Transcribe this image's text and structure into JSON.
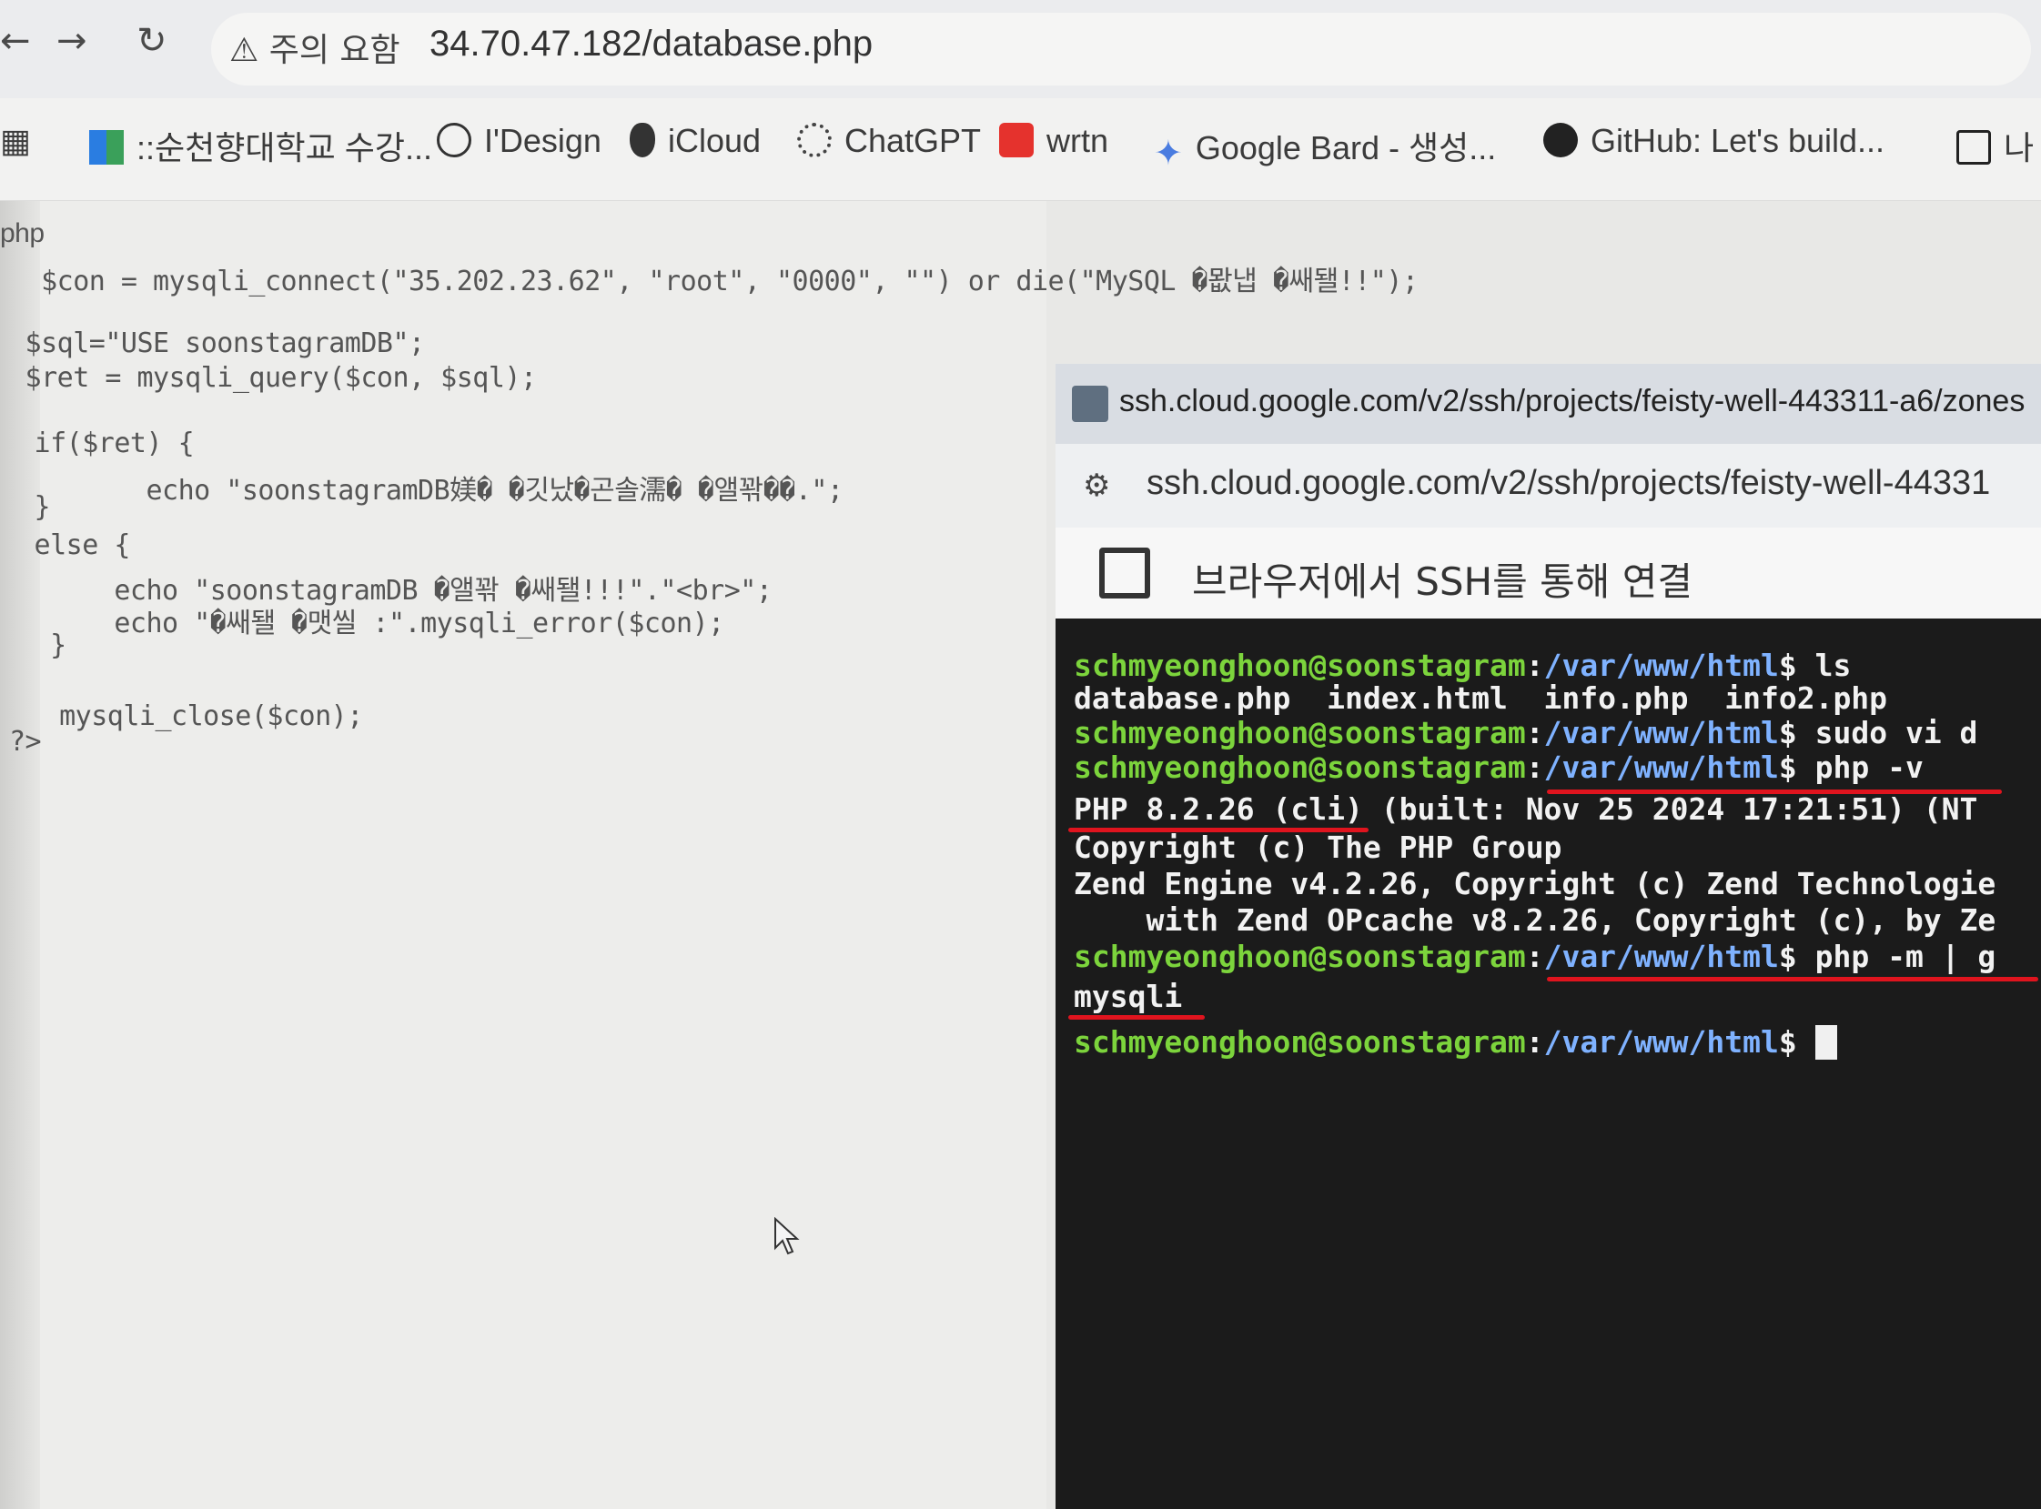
{
  "browser": {
    "security_label": "⚠ 주의 요함",
    "url": "34.70.47.182/database.php",
    "bookmarks": [
      {
        "label": "::순천향대학교 수강...",
        "icon": "bookmark-icon"
      },
      {
        "label": "I'Design",
        "icon": "globe-icon"
      },
      {
        "label": "iCloud",
        "icon": "apple-icon"
      },
      {
        "label": "ChatGPT",
        "icon": "openai-icon"
      },
      {
        "label": "wrtn",
        "icon": "wrtn-icon"
      },
      {
        "label": "Google Bard - 생성...",
        "icon": "sparkle-icon"
      },
      {
        "label": "GitHub: Let's build...",
        "icon": "github-icon"
      },
      {
        "label": "나",
        "icon": "notion-icon"
      }
    ]
  },
  "code": {
    "lines": [
      "php",
      "  $con = mysqli_connect(\"35.202.23.62\", \"root\", \"0000\", \"\") or die(\"MySQL �뫖냅 �쌔됄!!\");",
      "",
      " $sql=\"USE soonstagramDB\";",
      " $ret = mysqli_query($con, $sql);",
      "",
      " if($ret) {",
      "        echo \"soonstagramDB媄� �깃났�곤솔濡� �앨꽊��.\";",
      " }",
      " else {",
      "      echo \"soonstagramDB �앨꽊 �쌔됄!!!\".\"<br>\";",
      "      echo \"�쌔됄 �맷씰 :\".mysqli_error($con);",
      "  }",
      "",
      "  mysqli_close($con);",
      "?>"
    ]
  },
  "ssh": {
    "window_title": "ssh.cloud.google.com/v2/ssh/projects/feisty-well-443311-a6/zones",
    "address": "ssh.cloud.google.com/v2/ssh/projects/feisty-well-44331",
    "header": "브라우저에서 SSH를 통해 연결",
    "user_host": "schmyeonghoon@soonstagram",
    "path": "/var/www/html",
    "cmd1": " ls",
    "ls_output": "database.php  index.html  info.php  info2.php",
    "cmd2": " sudo vi d",
    "cmd3": " php -v",
    "php_version": "PHP 8.2.26 (cli) (built: Nov 25 2024 17:21:51) (NT",
    "copyright": "Copyright (c) The PHP Group",
    "zend": "Zend Engine v4.2.26, Copyright (c) Zend Technologie",
    "opcache": "    with Zend OPcache v8.2.26, Copyright (c), by Ze",
    "cmd4": " php -m | g",
    "module": "mysqli"
  },
  "colors": {
    "prompt_user": "#7cd43c",
    "prompt_path": "#7fb2ff",
    "underline": "#e0141e"
  }
}
